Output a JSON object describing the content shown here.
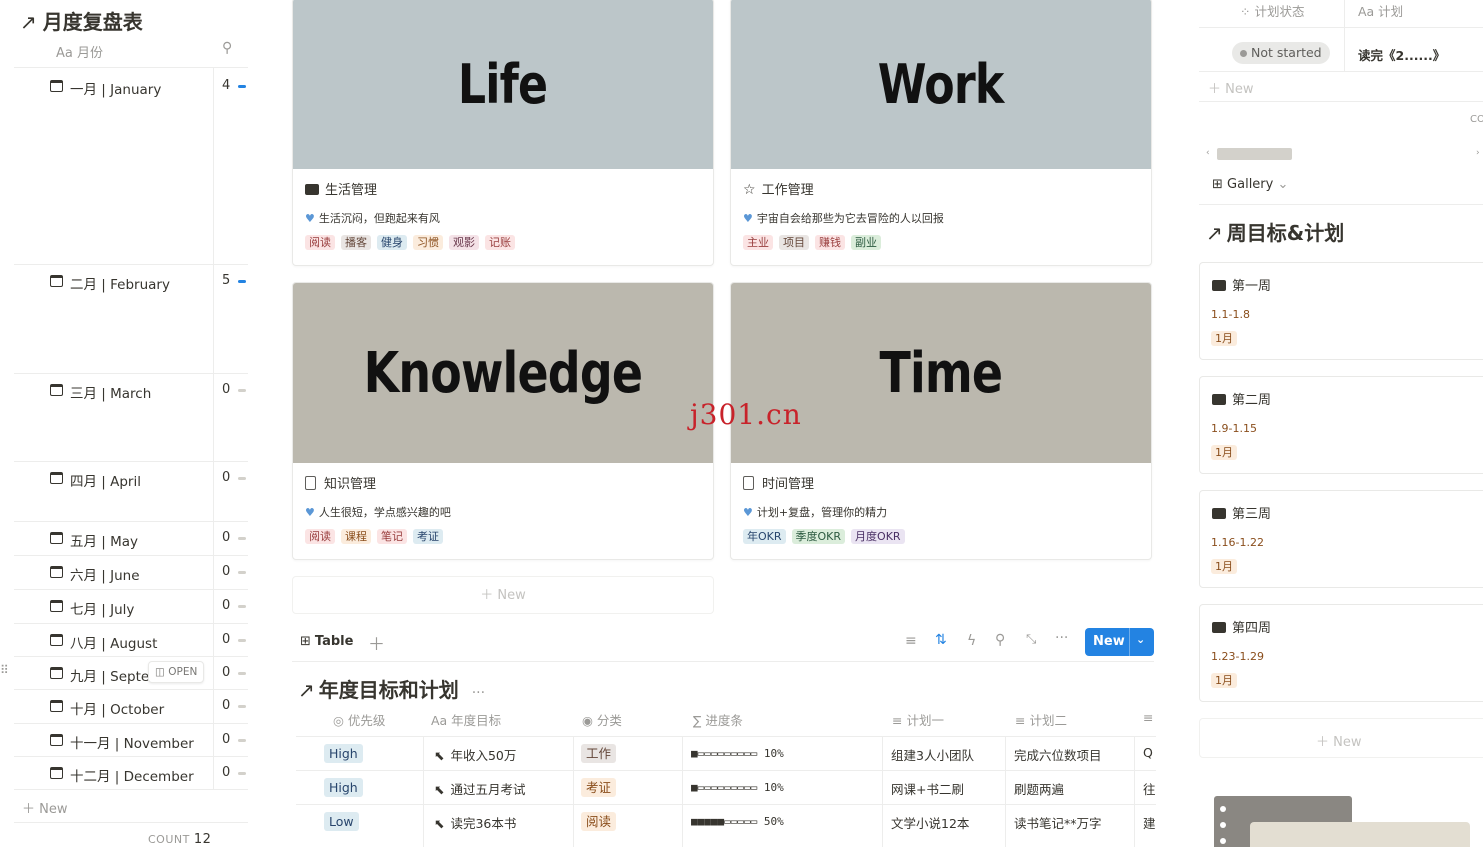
{
  "left": {
    "title": "月度复盘表",
    "column_header": "Aa 月份",
    "months": [
      {
        "label": "一月 | January",
        "count": "4"
      },
      {
        "label": "二月 | February",
        "count": "5"
      },
      {
        "label": "三月 | March",
        "count": "0"
      },
      {
        "label": "四月 | April",
        "count": "0"
      },
      {
        "label": "五月 | May",
        "count": "0"
      },
      {
        "label": "六月 | June",
        "count": "0"
      },
      {
        "label": "七月 | July",
        "count": "0"
      },
      {
        "label": "八月 | August",
        "count": "0"
      },
      {
        "label": "九月 | Septe",
        "count": "0"
      },
      {
        "label": "十月 | October",
        "count": "0"
      },
      {
        "label": "十一月 | November",
        "count": "0"
      },
      {
        "label": "十二月 | December",
        "count": "0"
      }
    ],
    "open_label": "OPEN",
    "new_label": "New",
    "count_label": "COUNT",
    "count_value": "12"
  },
  "gallery": {
    "cards": [
      {
        "cover": "Life",
        "title": "生活管理",
        "desc": "生活沉闷，但跑起来有风",
        "tags": [
          "阅读",
          "播客",
          "健身",
          "习惯",
          "观影",
          "记账"
        ]
      },
      {
        "cover": "Work",
        "title": "工作管理",
        "desc": "宇宙自会给那些为它去冒险的人以回报",
        "tags": [
          "主业",
          "项目",
          "赚钱",
          "副业"
        ]
      },
      {
        "cover": "Knowledge",
        "title": "知识管理",
        "desc": "人生很短，学点感兴趣的吧",
        "tags": [
          "阅读",
          "课程",
          "笔记",
          "考证"
        ]
      },
      {
        "cover": "Time",
        "title": "时间管理",
        "desc": "计划+复盘，管理你的精力",
        "tags": [
          "年OKR",
          "季度OKR",
          "月度OKR"
        ]
      }
    ],
    "new_label": "New"
  },
  "watermark": "j301.cn",
  "table": {
    "view_label": "Table",
    "new_button": "New",
    "title": "年度目标和计划",
    "headers": [
      "优先级",
      "Aa 年度目标",
      "分类",
      "进度条",
      "计划一",
      "计划二"
    ],
    "rows": [
      {
        "priority": "High",
        "goal": "年收入50万",
        "category": "工作",
        "progress": "■▭▭▭▭▭▭▭▭▭ 10%",
        "plan1": "组建3人小团队",
        "plan2": "完成六位数项目",
        "extra": "Q"
      },
      {
        "priority": "High",
        "goal": "通过五月考试",
        "category": "考证",
        "progress": "■▭▭▭▭▭▭▭▭▭ 10%",
        "plan1": "网课+书二刷",
        "plan2": "刷题两遍",
        "extra": "往"
      },
      {
        "priority": "Low",
        "goal": "读完36本书",
        "category": "阅读",
        "progress": "■■■■■▭▭▭▭▭ 50%",
        "plan1": "文学小说12本",
        "plan2": "读书笔记**万字",
        "extra": "建"
      }
    ]
  },
  "right": {
    "col_status": "计划状态",
    "col_plan": "Aa 计划",
    "status_value": "Not started",
    "plan_value": "读完《2......》",
    "new_label": "New",
    "gallery_label": "Gallery",
    "title": "周目标&计划",
    "weeks": [
      {
        "title": "第一周",
        "dates": "1.1-1.8",
        "month": "1月"
      },
      {
        "title": "第二周",
        "dates": "1.9-1.15",
        "month": "1月"
      },
      {
        "title": "第三周",
        "dates": "1.16-1.22",
        "month": "1月"
      },
      {
        "title": "第四周",
        "dates": "1.23-1.29",
        "month": "1月"
      }
    ],
    "new_label_2": "New"
  },
  "colors": {
    "accent": "#2383e2",
    "cover_grey": "#bcc6c9",
    "cover_beige": "#bbb8ae"
  }
}
